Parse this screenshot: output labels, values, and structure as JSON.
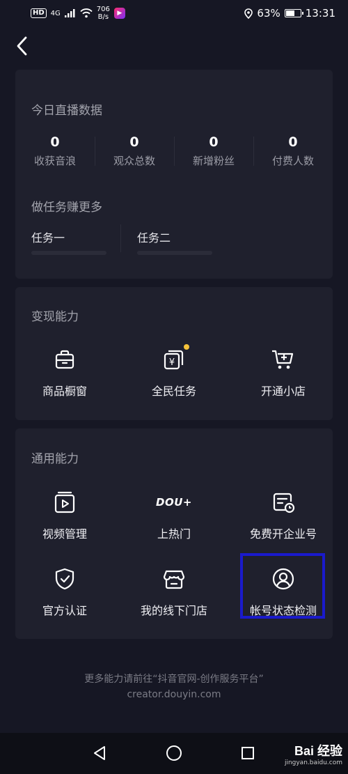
{
  "status_bar": {
    "hd": "HD",
    "network": "4G",
    "speed_value": "706",
    "speed_unit": "B/s",
    "battery": "63%",
    "battery_level": 0.63,
    "time": "13:31"
  },
  "live_data": {
    "title": "今日直播数据",
    "stats": [
      {
        "value": "0",
        "label": "收获音浪"
      },
      {
        "value": "0",
        "label": "观众总数"
      },
      {
        "value": "0",
        "label": "新增粉丝"
      },
      {
        "value": "0",
        "label": "付费人数"
      }
    ],
    "tasks_title": "做任务赚更多",
    "tasks": [
      {
        "label": "任务一"
      },
      {
        "label": "任务二"
      }
    ]
  },
  "monetize": {
    "title": "变现能力",
    "items": [
      {
        "label": "商品橱窗",
        "icon": "shop-window-icon"
      },
      {
        "label": "全民任务",
        "icon": "yuan-task-icon"
      },
      {
        "label": "开通小店",
        "icon": "cart-plus-icon"
      }
    ]
  },
  "general": {
    "title": "通用能力",
    "items": [
      {
        "label": "视频管理",
        "icon": "video-icon"
      },
      {
        "label": "上热门",
        "icon": "dou-plus-icon",
        "logo": "DOU+"
      },
      {
        "label": "免费开企业号",
        "icon": "enterprise-clock-icon"
      },
      {
        "label": "官方认证",
        "icon": "shield-check-icon"
      },
      {
        "label": "我的线下门店",
        "icon": "storefront-icon"
      },
      {
        "label": "帐号状态检测",
        "icon": "user-circle-icon"
      }
    ]
  },
  "footer": {
    "line1": "更多能力请前往“抖音官网-创作服务平台”",
    "line2": "creator.douyin.com"
  },
  "watermark": {
    "main": "Bai 经验",
    "sub": "jingyan.baidu.com"
  },
  "colors": {
    "background": "#161724",
    "card": "#1f202d",
    "highlight": "#1a1acc",
    "badge_dot": "#f5c23a"
  }
}
